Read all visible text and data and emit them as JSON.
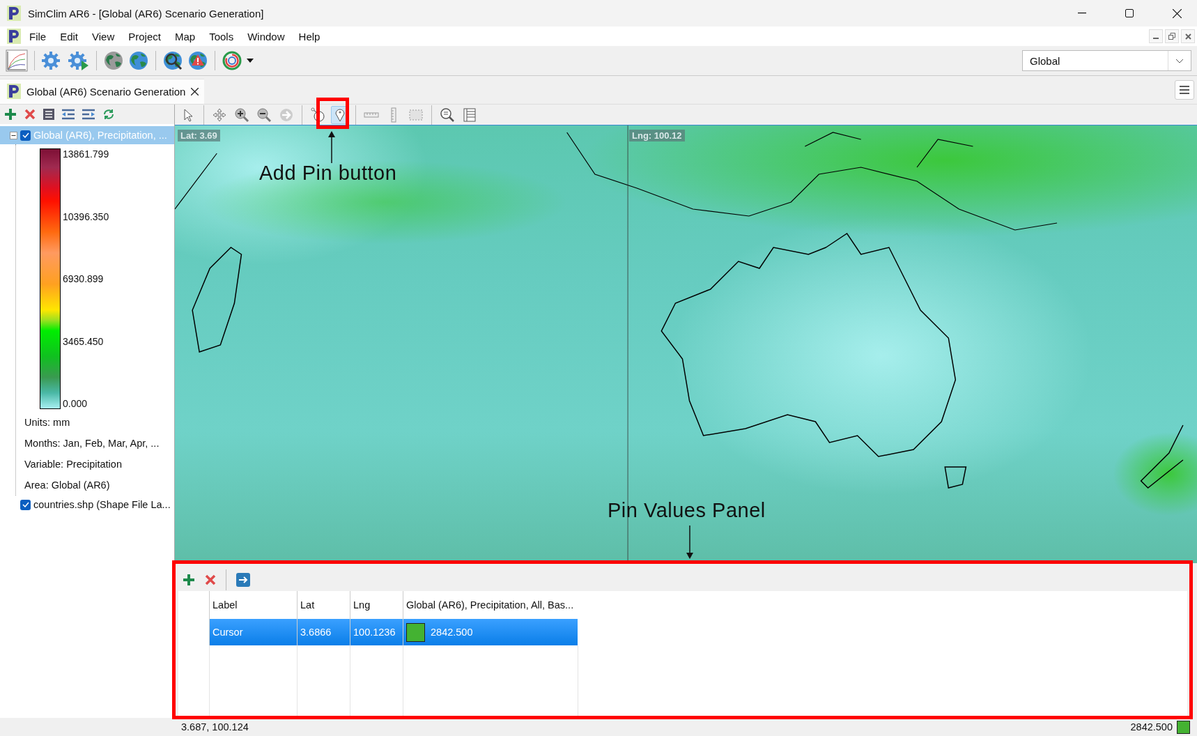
{
  "window": {
    "title": "SimClim AR6 - [Global (AR6) Scenario Generation]"
  },
  "menu": [
    "File",
    "Edit",
    "View",
    "Project",
    "Map",
    "Tools",
    "Window",
    "Help"
  ],
  "region_select": {
    "value": "Global"
  },
  "document_tab": {
    "label": "Global (AR6) Scenario Generation",
    "selected": true
  },
  "layers": [
    {
      "label": "Global (AR6), Precipitation, ...",
      "checked": true,
      "expanded": true,
      "selected": true,
      "legend": [
        "13861.799",
        "10396.350",
        "6930.899",
        "3465.450",
        "0.000"
      ],
      "children": [
        {
          "label": "Units: mm"
        },
        {
          "label": "Months: Jan, Feb, Mar, Apr, ..."
        },
        {
          "label": "Variable: Precipitation"
        },
        {
          "label": "Area: Global (AR6)"
        }
      ]
    },
    {
      "label": "countries.shp (Shape File La...",
      "checked": true,
      "selected": false
    }
  ],
  "map_tools": [
    {
      "kind": "select",
      "selected": false
    },
    {
      "kind": "pan",
      "selected": false
    },
    {
      "kind": "zoom-in",
      "selected": false
    },
    {
      "kind": "zoom-out",
      "selected": false
    },
    {
      "kind": "forward",
      "selected": false
    },
    {
      "kind": "info",
      "selected": false
    },
    {
      "kind": "pin",
      "selected": true
    },
    {
      "kind": "ruler-h",
      "selected": false
    },
    {
      "kind": "ruler-v",
      "selected": false
    },
    {
      "kind": "rect-select",
      "selected": false
    },
    {
      "kind": "find",
      "selected": false
    },
    {
      "kind": "list",
      "selected": false
    }
  ],
  "map": {
    "lat_label": "Lat: 3.69",
    "lng_label": "Lng: 100.12"
  },
  "annotations": [
    {
      "kind": "tool-callout",
      "text": "Add Pin button"
    },
    {
      "kind": "panel-callout",
      "text": "Pin Values Panel"
    }
  ],
  "pin_table": {
    "columns": [
      "Label",
      "Lat",
      "Lng",
      "Global (AR6), Precipitation, All, Bas..."
    ],
    "rows": [
      {
        "label": "Cursor",
        "lat": "3.6866",
        "lng": "100.1236",
        "value": "2842.500",
        "color": "#44b232",
        "selected": true
      }
    ]
  },
  "status_bar": {
    "coords": "3.687, 100.124",
    "value": "2842.500",
    "color": "#44b232"
  }
}
